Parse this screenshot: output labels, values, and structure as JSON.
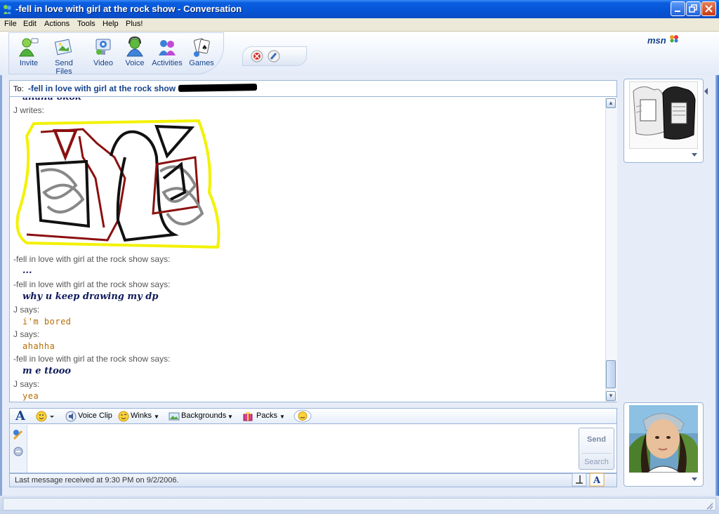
{
  "window": {
    "title": "-fell in love with girl at the rock show - Conversation"
  },
  "menu": [
    "File",
    "Edit",
    "Actions",
    "Tools",
    "Help",
    "Plus!"
  ],
  "toolbar": {
    "items": [
      {
        "label": "Invite",
        "icon": "invite-icon"
      },
      {
        "label": "Send Files",
        "icon": "send-files-icon"
      },
      {
        "label": "Video",
        "icon": "webcam-icon"
      },
      {
        "label": "Voice",
        "icon": "voice-icon"
      },
      {
        "label": "Activities",
        "icon": "activities-icon"
      },
      {
        "label": "Games",
        "icon": "games-icon"
      }
    ],
    "brand": "msn"
  },
  "to_bar": {
    "label": "To:",
    "contact": "-fell in love with girl at the rock show -"
  },
  "history": {
    "cut_line": "ahaha okok",
    "drawing_sender": "J writes:",
    "messages": [
      {
        "sender": "-fell in love with girl at the rock show says:",
        "text": "...",
        "style": "blue"
      },
      {
        "sender": "-fell in love with girl at the rock show says:",
        "text": "why u keep drawing my dp",
        "style": "blue"
      },
      {
        "sender": "J says:",
        "text": "i'm bored",
        "style": "orange"
      },
      {
        "sender": "J says:",
        "text": "ahahha",
        "style": "orange"
      },
      {
        "sender": "-fell in love with girl at the rock show says:",
        "text": "m e ttooo",
        "style": "blue"
      },
      {
        "sender": "J says:",
        "text": "yea",
        "style": "orange"
      }
    ]
  },
  "format_bar": {
    "font_label": "A",
    "voice_clip": "Voice Clip",
    "winks": "Winks",
    "backgrounds": "Backgrounds",
    "packs": "Packs"
  },
  "input": {
    "value": "",
    "send": "Send",
    "search": "Search"
  },
  "status": {
    "text": "Last message received at 9:30 PM on 9/2/2006."
  },
  "colors": {
    "accent": "#15428b",
    "message_blue": "#0f1a5c",
    "message_orange": "#b76d00",
    "doodle_yellow": "#f2f200",
    "doodle_red": "#8b1010"
  }
}
